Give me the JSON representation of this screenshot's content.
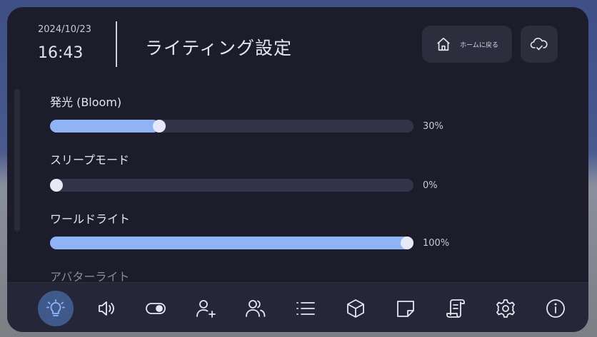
{
  "header": {
    "date": "2024/10/23",
    "time": "16:43",
    "title": "ライティング設定",
    "home_button_label": "ホームに戻る"
  },
  "settings": [
    {
      "label": "発光 (Bloom)",
      "value_text": "30%",
      "value": 0.3
    },
    {
      "label": "スリープモード",
      "value_text": "0%",
      "value": 0.0
    },
    {
      "label": "ワールドライト",
      "value_text": "100%",
      "value": 1.0
    },
    {
      "label": "アバターライト"
    }
  ],
  "bottom_nav": [
    {
      "icon": "lightbulb-icon",
      "active": true
    },
    {
      "icon": "speaker-icon"
    },
    {
      "icon": "toggle-icon"
    },
    {
      "icon": "add-user-icon"
    },
    {
      "icon": "users-icon"
    },
    {
      "icon": "list-icon"
    },
    {
      "icon": "cube-icon"
    },
    {
      "icon": "sticky-note-icon"
    },
    {
      "icon": "scroll-icon"
    },
    {
      "icon": "gear-icon"
    },
    {
      "icon": "info-icon"
    }
  ],
  "colors": {
    "panel": "#1c1c2b",
    "accent": "#8fb3f5",
    "track": "#33344a",
    "active_nav": "#3f5a8a"
  }
}
